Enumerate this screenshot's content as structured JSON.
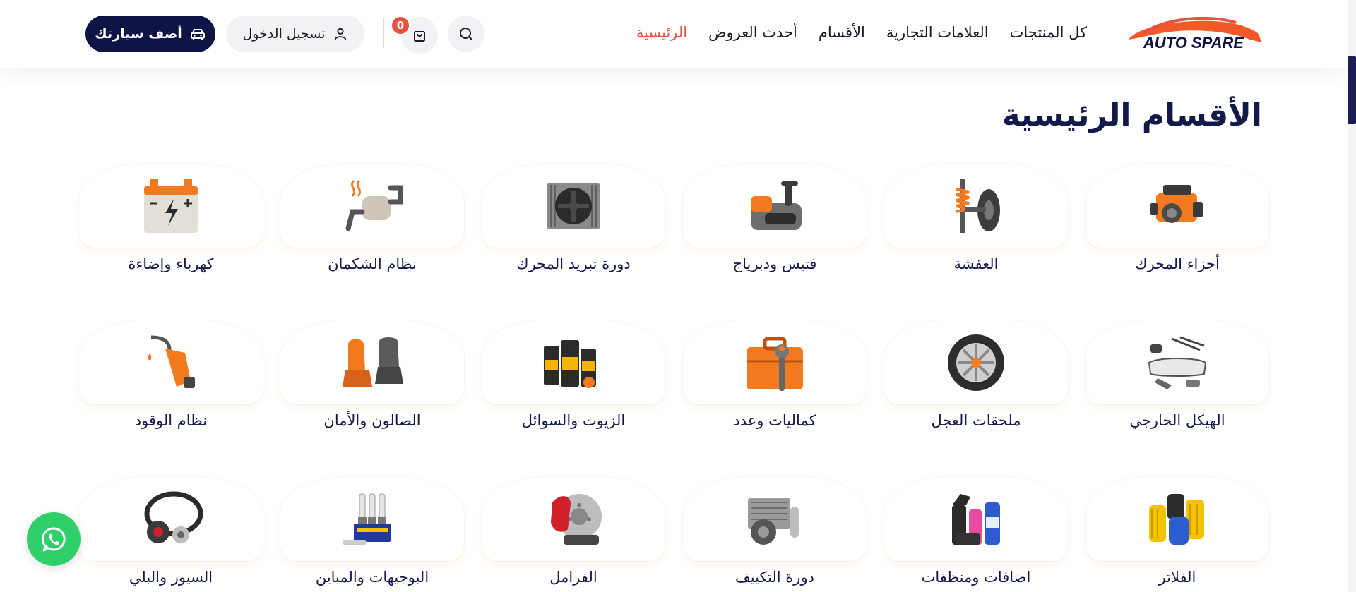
{
  "header": {
    "logo_text": "AUTO SPARE",
    "nav": [
      {
        "label": "الرئيسية",
        "active": true
      },
      {
        "label": "أحدث العروض",
        "active": false
      },
      {
        "label": "الأقسام",
        "active": false
      },
      {
        "label": "العلامات التجارية",
        "active": false
      },
      {
        "label": "كل المنتجات",
        "active": false
      }
    ],
    "cart_count": "0",
    "login_label": "تسجيل الدخول",
    "add_car_label": "أضف سيارتك"
  },
  "colors": {
    "accent": "#e8503f",
    "navy": "#0f1447",
    "whatsapp": "#2fd06a",
    "icon_orange": "#f47a20"
  },
  "main": {
    "section_title": "الأقسام الرئيسية",
    "categories": [
      {
        "label": "أجزاء المحرك",
        "icon": "engine-icon"
      },
      {
        "label": "العفشة",
        "icon": "suspension-icon"
      },
      {
        "label": "فتيس ودبرياج",
        "icon": "transmission-icon"
      },
      {
        "label": "دورة تبريد المحرك",
        "icon": "radiator-icon"
      },
      {
        "label": "نظام الشكمان",
        "icon": "exhaust-icon"
      },
      {
        "label": "كهرباء وإضاءة",
        "icon": "battery-icon"
      },
      {
        "label": "الهيكل الخارجي",
        "icon": "body-parts-icon"
      },
      {
        "label": "ملحقات العجل",
        "icon": "wheel-icon"
      },
      {
        "label": "كماليات وعدد",
        "icon": "toolbox-icon"
      },
      {
        "label": "الزيوت والسوائل",
        "icon": "oil-icon"
      },
      {
        "label": "الصالون والأمان",
        "icon": "car-seat-icon"
      },
      {
        "label": "نظام الوقود",
        "icon": "fuel-nozzle-icon"
      },
      {
        "label": "الفلاتر",
        "icon": "filters-icon"
      },
      {
        "label": "اضافات ومنظفات",
        "icon": "cleaners-icon"
      },
      {
        "label": "دورة التكييف",
        "icon": "ac-compressor-icon"
      },
      {
        "label": "الفرامل",
        "icon": "brakes-icon"
      },
      {
        "label": "البوجيهات والمباين",
        "icon": "spark-plugs-icon"
      },
      {
        "label": "السيور والبلي",
        "icon": "belts-icon"
      }
    ]
  }
}
